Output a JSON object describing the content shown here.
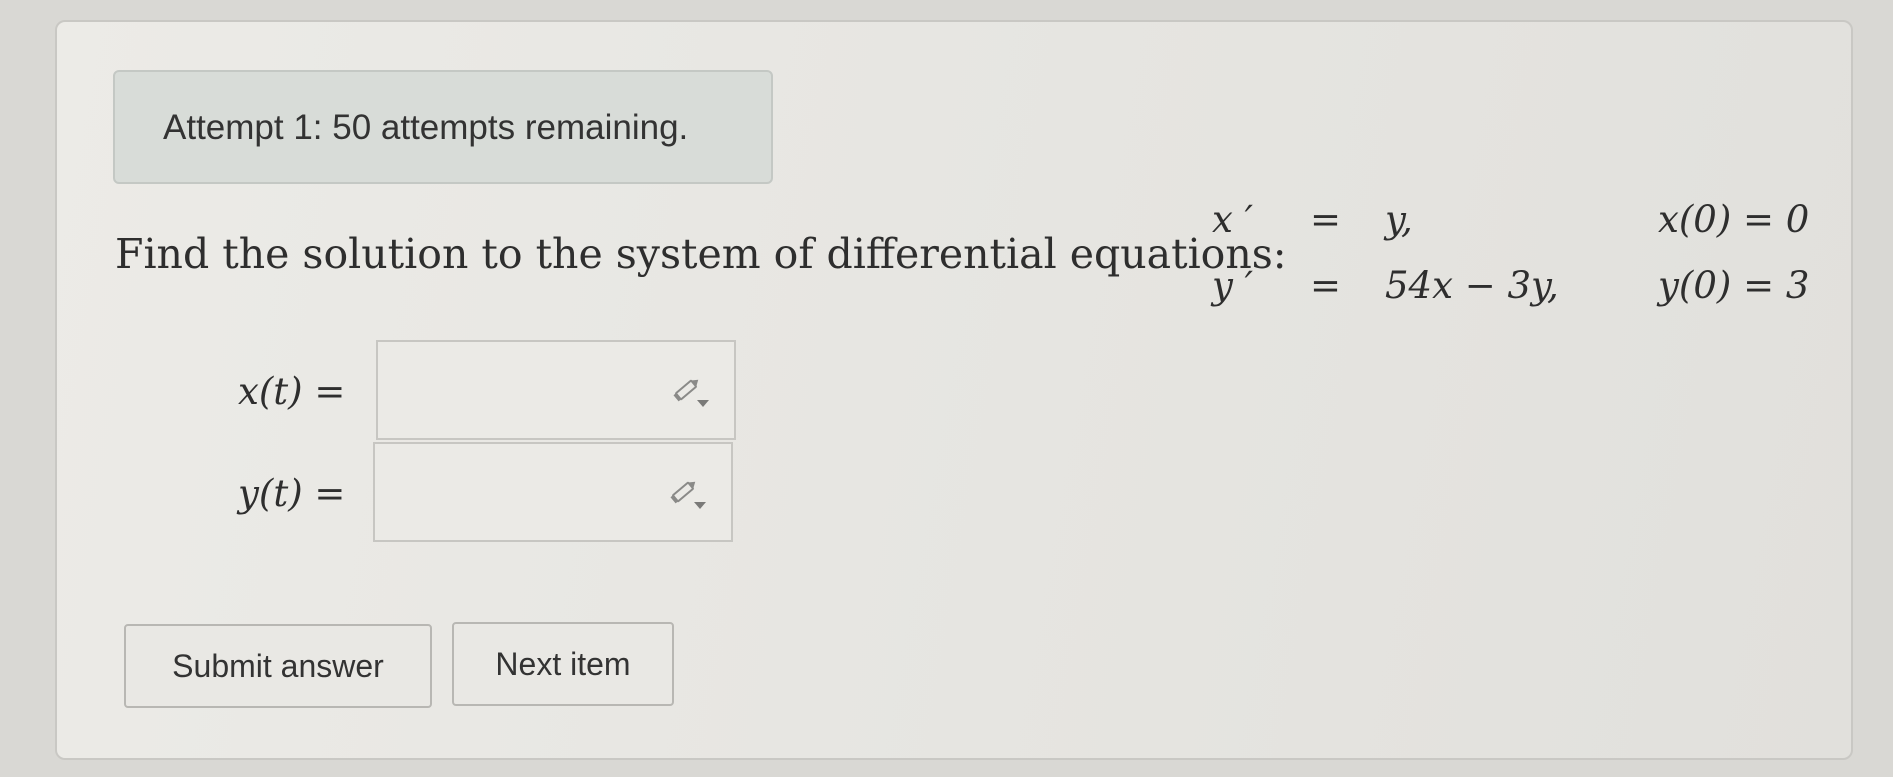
{
  "attempt_banner": "Attempt 1: 50 attempts remaining.",
  "problem": {
    "prompt": "Find the solution to the system of differential equations:",
    "equations": [
      {
        "lhs": "x ′",
        "eq": "=",
        "rhs": "y,",
        "initial": "x(0) = 0"
      },
      {
        "lhs": "y ′",
        "eq": "=",
        "rhs": "54x − 3y,",
        "initial": "y(0) = 3"
      }
    ]
  },
  "answers": [
    {
      "label": "x(t) =",
      "value": ""
    },
    {
      "label": "y(t) =",
      "value": ""
    }
  ],
  "buttons": {
    "submit": "Submit answer",
    "next": "Next item"
  },
  "icons": {
    "answer_tool": "pencil-dropdown-icon"
  }
}
